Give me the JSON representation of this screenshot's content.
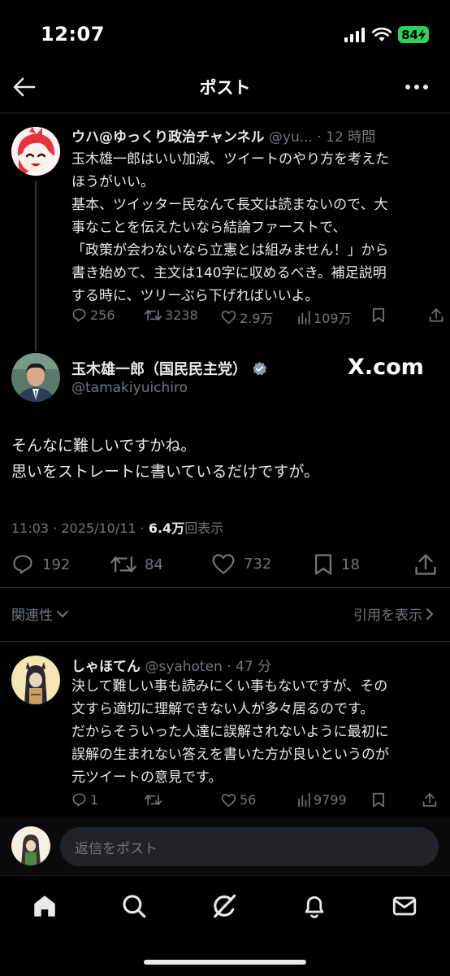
{
  "status_bar": {
    "time": "12:07",
    "battery": "84"
  },
  "header": {
    "title": "ポスト"
  },
  "parent_tweet": {
    "name": "ウハ@ゆっくり政治チャンネル",
    "handle": "@yu...",
    "separator": " · ",
    "time": "12 時間",
    "lines": [
      "玉木雄一郎はいい加減、ツイートのやり方を考えた",
      "ほうがいい。",
      "基本、ツイッター民なんて長文は読まないので、大",
      "事なことを伝えたいなら結論ファーストで、",
      "「政策が会わないなら立憲とは組みません！」から",
      "書き始めて、主文は140字に収めるべき。補足説明",
      "する時に、ツリーぶら下げればいいよ。"
    ],
    "replies": "256",
    "reposts": "3238",
    "likes": "2.9万",
    "views": "109万"
  },
  "main_tweet": {
    "name": "玉木雄一郎（国民民主党）",
    "handle": "@tamakiyuichiro",
    "watermark": "X.com",
    "lines": [
      "そんなに難しいですかね。",
      "思いをストレートに書いているだけですが。"
    ],
    "timestamp": "11:03 · 2025/10/11 · ",
    "views": "6.4万",
    "views_suffix": "回表示",
    "replies": "192",
    "reposts": "84",
    "likes": "732",
    "bookmarks": "18"
  },
  "sort": {
    "label": "関連性",
    "quotes_label": "引用を表示"
  },
  "reply_tweet": {
    "name": "しゃほてん",
    "handle": "@syahoten",
    "separator": " · ",
    "time": "47 分",
    "lines": [
      "決して難しい事も読みにくい事もないですが、その",
      "文すら適切に理解できない人が多々居るのです。",
      "だからそういった人達に誤解されないように最初に",
      "誤解の生まれない答えを書いた方が良いというのが",
      "元ツイートの意見です。"
    ],
    "replies": "1",
    "likes": "56",
    "views": "9799"
  },
  "composer": {
    "placeholder": "返信をポスト"
  },
  "colors": {
    "background": "#000000",
    "text": "#e7e9ea",
    "muted": "#71767b",
    "verified": "#829aab",
    "battery": "#30d158"
  }
}
